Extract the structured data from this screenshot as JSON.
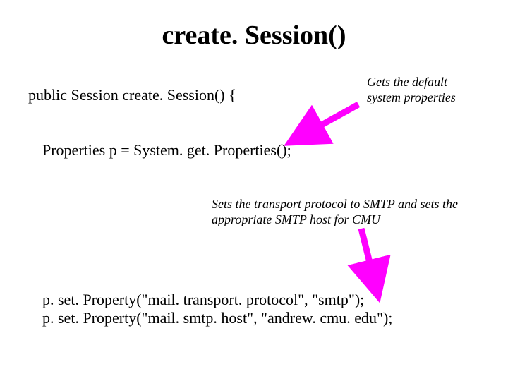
{
  "title": "create. Session()",
  "code": {
    "line1": "public Session create. Session() {",
    "line2": "Properties p = System. get. Properties();",
    "line3": "p. set. Property(\"mail. transport. protocol\", \"smtp\");",
    "line4": "p. set. Property(\"mail. smtp. host\", \"andrew. cmu. edu\");"
  },
  "annotations": {
    "note1_l1": "Gets the default",
    "note1_l2": "system properties",
    "note2_l1": "Sets the transport protocol to SMTP and sets the",
    "note2_l2": "appropriate SMTP host for CMU"
  },
  "colors": {
    "arrow": "#ff00ff"
  }
}
